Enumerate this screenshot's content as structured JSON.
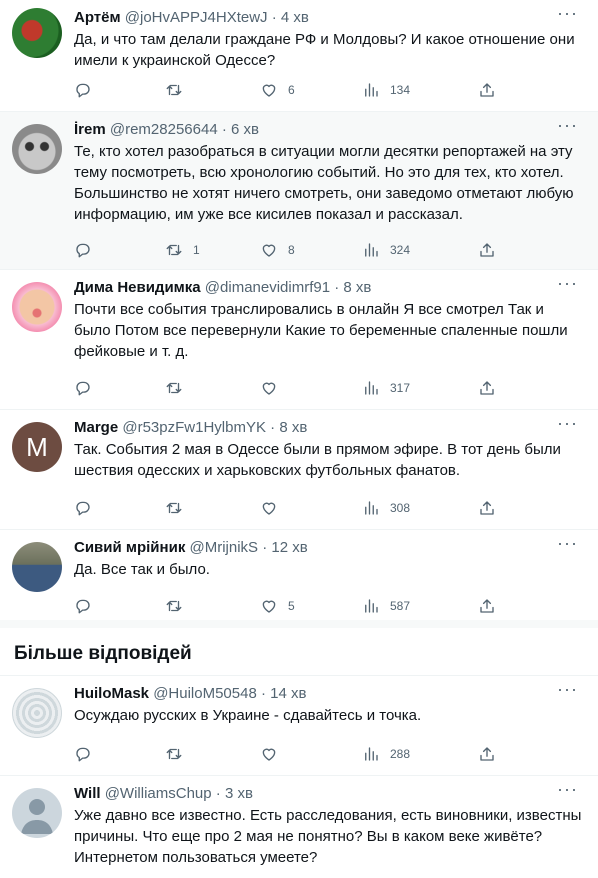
{
  "tweets": [
    {
      "name": "Артём",
      "handle": "@joHvAPPJ4HXtewJ",
      "time": "4 хв",
      "text": "Да, и что там делали граждане РФ и Молдовы? И какое отношение они имели к украинской Одессе?",
      "replies": "",
      "retweets": "",
      "likes": "6",
      "views": "134"
    },
    {
      "name": "İrem",
      "handle": "@rem28256644",
      "time": "6 хв",
      "text": "Те, кто хотел разобраться в ситуации могли десятки репортажей на эту тему посмотреть, всю хронологию событий. Но это для тех, кто хотел. Большинство не хотят ничего смотреть, они заведомо отметают любую информацию, им уже все кисилев показал и рассказал.",
      "replies": "",
      "retweets": "1",
      "likes": "8",
      "views": "324"
    },
    {
      "name": "Дима Невидимка",
      "handle": "@dimanevidimrf91",
      "time": "8 хв",
      "text": "Почти все события транслировались в онлайн Я все смотрел Так и было Потом все перевернули Какие то беременные спаленные пошли фейковые и т. д.",
      "replies": "",
      "retweets": "",
      "likes": "",
      "views": "317"
    },
    {
      "name": "Marge",
      "handle": "@r53pzFw1HylbmYK",
      "time": "8 хв",
      "text": "Так. События 2 мая в Одессе были в прямом эфире. В тот день были шествия одесских и харьковских футбольных фанатов.",
      "replies": "",
      "retweets": "",
      "likes": "",
      "views": "308"
    },
    {
      "name": "Сивий мрійник",
      "handle": "@MrijnikS",
      "time": "12 хв",
      "text": "Да. Все так и было.",
      "replies": "",
      "retweets": "",
      "likes": "5",
      "views": "587"
    }
  ],
  "more_replies_title": "Більше відповідей",
  "more_tweets": [
    {
      "name": "HuiloMask",
      "handle": "@HuiloM50548",
      "time": "14 хв",
      "text": "Осуждаю русских в Украине - сдавайтесь и точка.",
      "replies": "",
      "retweets": "",
      "likes": "",
      "views": "288"
    },
    {
      "name": "Will",
      "handle": "@WilliamsChup",
      "time": "3 хв",
      "text": "Уже давно все известно. Есть расследования, есть виновники, известны причины. Что еще про 2 мая не понятно? Вы в каком веке живёте? Интернетом пользоваться умеете?"
    }
  ],
  "avatar_initial_marge": "M",
  "colors": {
    "text": "#0f1419",
    "muted": "#536471",
    "border": "#eff3f4",
    "highlight": "#f7f9f9",
    "marge_avatar": "#6d4c41"
  },
  "icons": [
    "reply-icon",
    "retweet-icon",
    "like-icon",
    "views-icon",
    "share-icon",
    "more-icon"
  ]
}
